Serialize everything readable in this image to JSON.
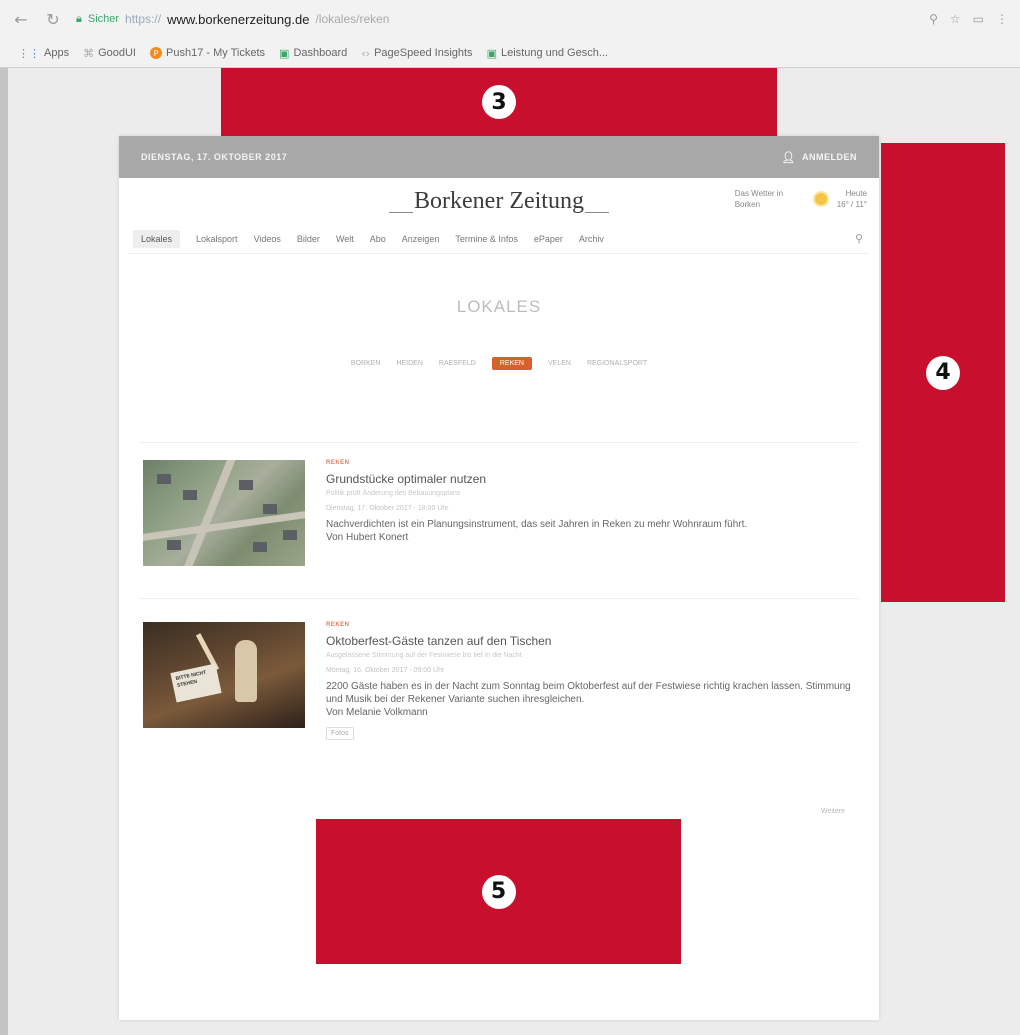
{
  "browser": {
    "nav_icons": {
      "back": "←",
      "reload": "↻"
    },
    "security_label": "Sicher",
    "url_scheme": "https://",
    "url_domain": "www.borkenerzeitung.de",
    "url_rest": "/lokales/reken",
    "toolbar_icons": [
      "⚲",
      "☆",
      "▭",
      "⋮"
    ],
    "bookmarks": [
      {
        "icon": "grid-icon",
        "glyph": "⋮⋮",
        "label": "Apps"
      },
      {
        "icon": "link-icon",
        "glyph": "⌘",
        "label": "GoodUI"
      },
      {
        "icon": "push-icon",
        "glyph": "P",
        "label": "Push17 - My Tickets"
      },
      {
        "icon": "doc-icon",
        "glyph": "▣",
        "label": "Dashboard"
      },
      {
        "icon": "speed-icon",
        "glyph": "‹›",
        "label": "PageSpeed Insights"
      },
      {
        "icon": "doc-icon",
        "glyph": "▣",
        "label": "Leistung und Gesch..."
      }
    ]
  },
  "site": {
    "topbar": {
      "date": "DIENSTAG, 17. OKTOBER 2017",
      "login": "ANMELDEN"
    },
    "logo": "Borkener Zeitung",
    "weather": {
      "place": "Das Wetter in Borken",
      "temp": "16° / 11°",
      "label": "Heute"
    },
    "nav": [
      "Lokales",
      "Lokalsport",
      "Videos",
      "Bilder",
      "Welt",
      "Abo",
      "Anzeigen",
      "Termine & Infos",
      "ePaper",
      "Archiv"
    ],
    "section_title": "LOKALES",
    "subnav": [
      "BORKEN",
      "HEIDEN",
      "RAESFELD",
      "REKEN",
      "VELEN",
      "REGIONALSPORT"
    ],
    "subnav_active": 3,
    "articles": [
      {
        "kicker": "REKEN",
        "headline": "Grundstücke optimaler nutzen",
        "subline": "Politik prüft Änderung des Bebauungsplans",
        "date": "Dienstag, 17. Oktober 2017 - 18:00 Uhr",
        "teaser": "Nachverdichten ist ein Planungsinstrument, das seit Jahren in Reken zu mehr Wohnraum führt.",
        "author": "Von Hubert Konert"
      },
      {
        "kicker": "REKEN",
        "headline": "Oktoberfest-Gäste tanzen auf den Tischen",
        "subline": "Ausgelassene Stimmung auf der Festwiese bis tief in die Nacht",
        "date": "Montag, 16. Oktober 2017 - 09:00 Uhr",
        "teaser": "2200 Gäste haben es in der Nacht zum Sonntag beim Oktoberfest auf der Festwiese richtig krachen lassen. Stimmung und Musik bei der Rekener Variante suchen ihresgleichen.",
        "author": "Von Melanie Volkmann",
        "tag": "Fotos",
        "sign_text": "BITTE NICHT STEHEN"
      }
    ],
    "more": "Weitere"
  },
  "annotations": [
    "3",
    "4",
    "5"
  ],
  "colors": {
    "annotation": "#c8102e",
    "accent": "#d9602c"
  }
}
